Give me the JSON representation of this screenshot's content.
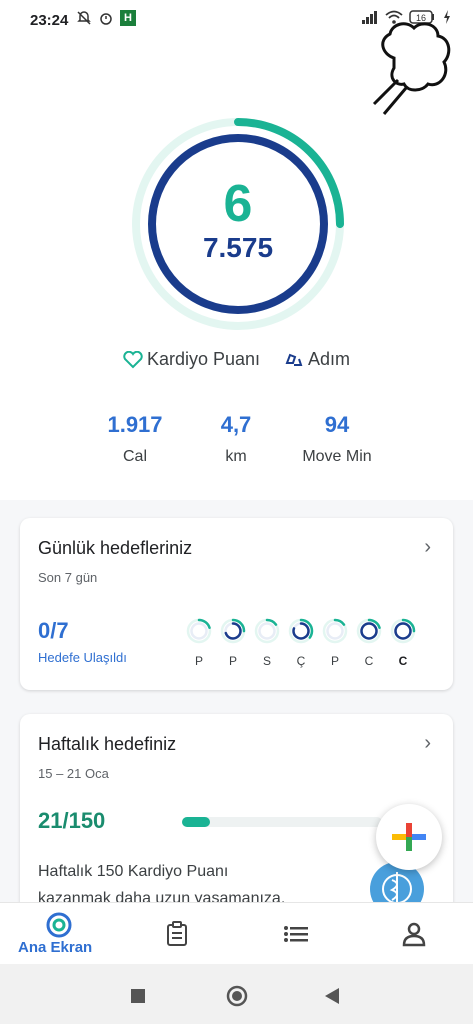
{
  "status": {
    "time": "23:24",
    "battery": "16"
  },
  "header": {
    "logo_icon": "fit-breath-icon"
  },
  "summary": {
    "cardio_points": "6",
    "steps": "7.575",
    "cardio_progress": 0.25,
    "steps_progress": 1.0,
    "legend": [
      {
        "label": "Kardiyo Puanı",
        "icon": "heart-icon"
      },
      {
        "label": "Adım",
        "icon": "steps-icon"
      }
    ]
  },
  "stats": [
    {
      "value": "1.917",
      "label": "Cal"
    },
    {
      "value": "4,7",
      "label": "km"
    },
    {
      "value": "94",
      "label": "Move Min"
    }
  ],
  "daily_goals": {
    "title": "Günlük hedefleriniz",
    "subtitle": "Son 7 gün",
    "achieved": "0/7",
    "achieved_label": "Hedefe Ulaşıldı",
    "days": [
      {
        "label": "P",
        "fill": 0.2,
        "steps_fill": 0.0
      },
      {
        "label": "P",
        "fill": 0.25,
        "steps_fill": 0.7
      },
      {
        "label": "S",
        "fill": 0.15,
        "steps_fill": 0.0
      },
      {
        "label": "Ç",
        "fill": 0.35,
        "steps_fill": 0.8
      },
      {
        "label": "P",
        "fill": 0.15,
        "steps_fill": 0.0
      },
      {
        "label": "C",
        "fill": 0.2,
        "steps_fill": 1.0
      },
      {
        "label": "C",
        "fill": 0.25,
        "steps_fill": 1.0,
        "today": true
      }
    ]
  },
  "weekly_goal": {
    "title": "Haftalık hedefiniz",
    "dates": "15 – 21 Oca",
    "value": "21/150",
    "progress": 0.14,
    "desc_line1": "Haftalık 150 Kardiyo Puanı",
    "desc_line2": "kazanmak daha uzun yaşamanıza,"
  },
  "nav": {
    "home_label": "Ana Ekran"
  },
  "colors": {
    "teal": "#1ab394",
    "blue": "#1a3c8c",
    "accent": "#2f6fd1"
  }
}
